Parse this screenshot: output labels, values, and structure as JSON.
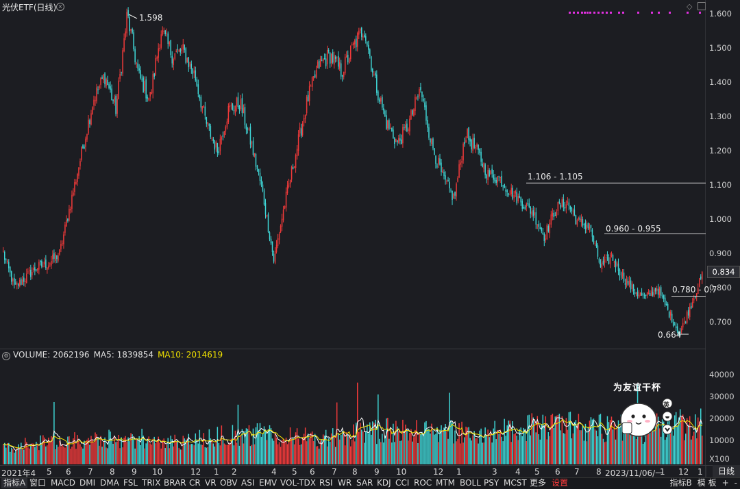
{
  "chart_title": "光伏ETF(日线)",
  "toolbar_icons": [
    "diamond-icon",
    "minus-icon",
    "chevron-up-icon"
  ],
  "price_axis": {
    "labels": [
      "1.600",
      "1.500",
      "1.400",
      "1.300",
      "1.200",
      "1.100",
      "1.000",
      "0.900",
      "0.800",
      "0.700"
    ],
    "last_price": "0.834"
  },
  "volume": {
    "legend_volume": "VOLUME: 2062196",
    "legend_ma5": "MA5: 1839854",
    "legend_ma10": "MA10: 2014619",
    "axis_labels": [
      "40000",
      "30000",
      "20000",
      "10000"
    ],
    "unit": "X100"
  },
  "annotations": {
    "high": "1.598",
    "low": "0.664",
    "level1": "1.106 - 1.105",
    "level2": "0.960 - 0.955",
    "level3": "0.780 - 0.7"
  },
  "date_axis": [
    "2021年4",
    "5",
    "6",
    "7",
    "8",
    "9",
    "10",
    "12",
    "1",
    "2",
    "4",
    "5",
    "6",
    "7",
    "8",
    "9",
    "10",
    "12",
    "1",
    "3",
    "4",
    "5",
    "6",
    "7",
    "8",
    "2023/11/06/一",
    "1",
    "12",
    "1"
  ],
  "period": "日线",
  "indicator_tabs": [
    "指标A",
    "窗口",
    "MACD",
    "DMI",
    "DMA",
    "FSL",
    "TRIX",
    "BRAR",
    "CR",
    "VR",
    "OBV",
    "ASI",
    "EMV",
    "VOL-TDX",
    "RSI",
    "WR",
    "SAR",
    "KDJ",
    "CCI",
    "ROC",
    "MTM",
    "BOLL",
    "PSY",
    "MCST",
    "更多",
    "设置"
  ],
  "right_tabs": [
    "指标B",
    "模 板",
    "+",
    "-"
  ],
  "sticker_text": "为友谊干杯",
  "sticker_bubbles": [
    "英"
  ],
  "colors": {
    "up": "#f03a3a",
    "down": "#3fd6d6",
    "ma5": "#ffffff",
    "ma10": "#f2e200",
    "accent_magenta": "#e030e0",
    "background": "#1c1d22"
  },
  "chart_data": {
    "type": "candlestick",
    "title": "光伏ETF(日线)",
    "ylim": [
      0.64,
      1.62
    ],
    "price_path": [
      [
        "2021-04",
        0.9
      ],
      [
        "2021-04",
        0.8
      ],
      [
        "2021-05",
        0.83
      ],
      [
        "2021-05",
        0.86
      ],
      [
        "2021-06",
        0.87
      ],
      [
        "2021-06",
        0.9
      ],
      [
        "2021-07",
        1.05
      ],
      [
        "2021-07",
        1.2
      ],
      [
        "2021-08",
        1.35
      ],
      [
        "2021-08",
        1.42
      ],
      [
        "2021-08",
        1.32
      ],
      [
        "2021-09",
        1.598
      ],
      [
        "2021-09",
        1.42
      ],
      [
        "2021-10",
        1.35
      ],
      [
        "2021-10",
        1.55
      ],
      [
        "2021-11",
        1.48
      ],
      [
        "2021-12",
        1.49
      ],
      [
        "2021-12",
        1.42
      ],
      [
        "2022-01",
        1.28
      ],
      [
        "2022-01",
        1.2
      ],
      [
        "2022-02",
        1.32
      ],
      [
        "2022-02",
        1.34
      ],
      [
        "2022-03",
        1.22
      ],
      [
        "2022-04",
        1.08
      ],
      [
        "2022-04",
        0.88
      ],
      [
        "2022-05",
        1.05
      ],
      [
        "2022-05",
        1.2
      ],
      [
        "2022-06",
        1.35
      ],
      [
        "2022-06",
        1.45
      ],
      [
        "2022-07",
        1.48
      ],
      [
        "2022-07",
        1.43
      ],
      [
        "2022-08",
        1.5
      ],
      [
        "2022-08",
        1.56
      ],
      [
        "2022-09",
        1.4
      ],
      [
        "2022-09",
        1.28
      ],
      [
        "2022-10",
        1.22
      ],
      [
        "2022-11",
        1.28
      ],
      [
        "2022-12",
        1.38
      ],
      [
        "2022-12",
        1.22
      ],
      [
        "2023-01",
        1.12
      ],
      [
        "2023-01",
        1.06
      ],
      [
        "2023-02",
        1.25
      ],
      [
        "2023-02",
        1.2
      ],
      [
        "2023-03",
        1.13
      ],
      [
        "2023-04",
        1.12
      ],
      [
        "2023-04",
        1.08
      ],
      [
        "2023-05",
        1.05
      ],
      [
        "2023-05",
        1.02
      ],
      [
        "2023-06",
        0.95
      ],
      [
        "2023-06",
        1.03
      ],
      [
        "2023-07",
        1.05
      ],
      [
        "2023-07",
        0.99
      ],
      [
        "2023-08",
        0.98
      ],
      [
        "2023-08",
        0.86
      ],
      [
        "2023-09",
        0.89
      ],
      [
        "2023-09",
        0.83
      ],
      [
        "2023-10",
        0.79
      ],
      [
        "2023-11",
        0.77
      ],
      [
        "2023-11",
        0.8
      ],
      [
        "2023-12",
        0.73
      ],
      [
        "2024-01",
        0.664
      ],
      [
        "2024-01",
        0.75
      ],
      [
        "2024-02",
        0.834
      ]
    ],
    "volume_range": [
      0,
      48000
    ],
    "volume_unit": "X100"
  }
}
